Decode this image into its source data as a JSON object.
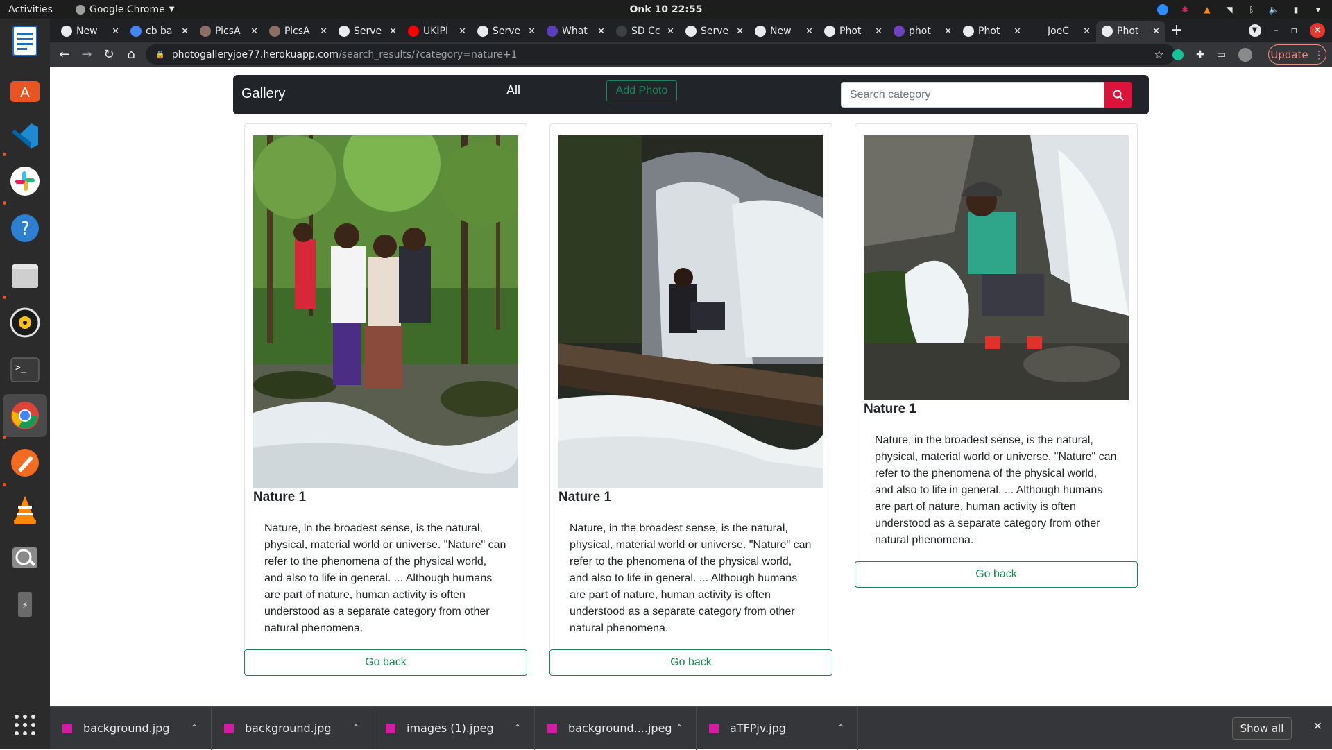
{
  "system": {
    "activities": "Activities",
    "app_name": "Google Chrome",
    "clock": "Onk 10  22:55"
  },
  "dock": {
    "items": [
      "libreoffice-writer-icon",
      "ubuntu-software-icon",
      "vscode-icon",
      "slack-icon",
      "help-icon",
      "files-icon",
      "rhythmbox-icon",
      "terminal-icon",
      "chrome-icon",
      "inkscape-icon",
      "vlc-icon",
      "screenshot-icon",
      "usb-drive-icon",
      "show-apps-icon"
    ]
  },
  "tabs": [
    {
      "title": "New",
      "color": "#e8eaed"
    },
    {
      "title": "cb ba",
      "color": "#4285f4"
    },
    {
      "title": "PicsA",
      "color": "#8d6e63"
    },
    {
      "title": "PicsA",
      "color": "#8d6e63"
    },
    {
      "title": "Serve",
      "color": "#e8eaed"
    },
    {
      "title": "UKIPI",
      "color": "#ff0000"
    },
    {
      "title": "Serve",
      "color": "#e8eaed"
    },
    {
      "title": "What",
      "color": "#5b3ebc"
    },
    {
      "title": "SD Cc",
      "color": "#3c4043"
    },
    {
      "title": "Serve",
      "color": "#e8eaed"
    },
    {
      "title": "New",
      "color": "#e8eaed"
    },
    {
      "title": "Phot",
      "color": "#e8eaed"
    },
    {
      "title": "phot",
      "color": "#6f42c1"
    },
    {
      "title": "Phot",
      "color": "#e8eaed"
    },
    {
      "title": "JoeC",
      "color": "#202124"
    },
    {
      "title": "Phot",
      "color": "#e8eaed",
      "active": true
    }
  ],
  "toolbar": {
    "url_host": "photogalleryjoe77.herokuapp.com",
    "url_path": "/search_results/?category=nature+1",
    "update_label": "Update"
  },
  "nav": {
    "brand": "Gallery",
    "all_label": "All",
    "add_photo_label": "Add Photo",
    "search_placeholder": "Search category"
  },
  "cards": [
    {
      "name": "Nature 1",
      "description": "Nature, in the broadest sense, is the natural, physical, material world or universe. \"Nature\" can refer to the phenomena of the physical world, and also to life in general. ... Although humans are part of nature, human activity is often understood as a separate category from other natural phenomena.",
      "button_label": "Go back"
    },
    {
      "name": "Nature 1",
      "description": "Nature, in the broadest sense, is the natural, physical, material world or universe. \"Nature\" can refer to the phenomena of the physical world, and also to life in general. ... Although humans are part of nature, human activity is often understood as a separate category from other natural phenomena.",
      "button_label": "Go back"
    },
    {
      "name": "Nature 1",
      "description": "Nature, in the broadest sense, is the natural, physical, material world or universe. \"Nature\" can refer to the phenomena of the physical world, and also to life in general. ... Although humans are part of nature, human activity is often understood as a separate category from other natural phenomena.",
      "button_label": "Go back"
    }
  ],
  "downloads": {
    "items": [
      "background.jpg",
      "background.jpg",
      "images (1).jpeg",
      "background....jpeg",
      "aTFPjv.jpg"
    ],
    "show_all_label": "Show all"
  }
}
